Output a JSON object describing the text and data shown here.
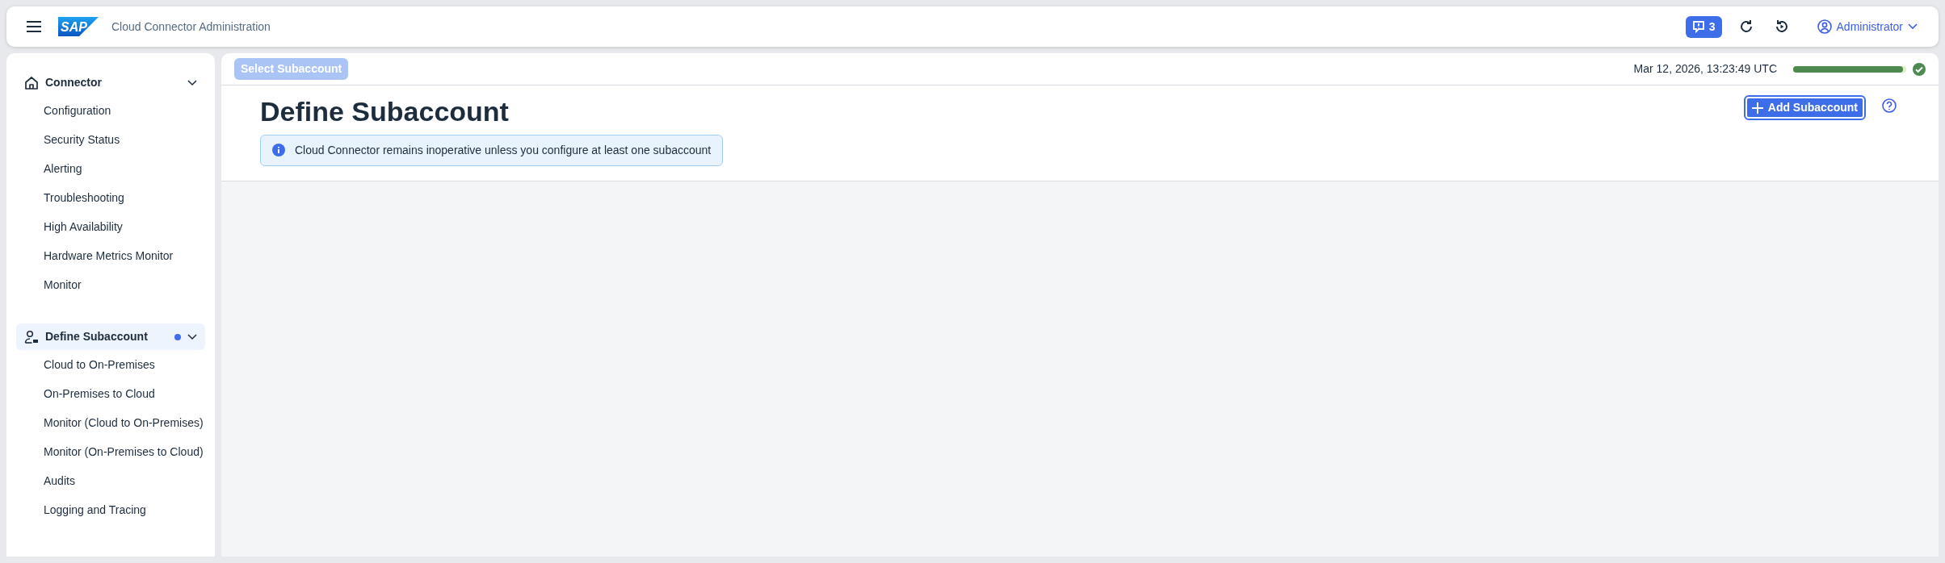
{
  "header": {
    "logo": "SAP",
    "title": "Cloud Connector Administration",
    "notifications": {
      "count": "3"
    },
    "user": {
      "name": "Administrator"
    }
  },
  "sidebar": {
    "groups": [
      {
        "label": "Connector",
        "expanded": true,
        "selected": false,
        "items": [
          "Configuration",
          "Security Status",
          "Alerting",
          "Troubleshooting",
          "High Availability",
          "Hardware Metrics Monitor",
          "Monitor"
        ]
      },
      {
        "label": "Define Subaccount",
        "expanded": true,
        "selected": true,
        "items": [
          "Cloud to On-Premises",
          "On-Premises to Cloud",
          "Monitor (Cloud to On-Premises)",
          "Monitor (On-Premises to Cloud)",
          "Audits",
          "Logging and Tracing"
        ]
      }
    ]
  },
  "toolbar": {
    "subaccount_button": {
      "label": "Select Subaccount",
      "disabled": true
    },
    "timestamp": "Mar 12, 2026, 13:23:49 UTC",
    "health": {
      "level": 0.97
    }
  },
  "page": {
    "title": "Define Subaccount",
    "add_button": "Add Subaccount",
    "info": "Cloud Connector remains inoperative unless you configure at least one subaccount"
  }
}
